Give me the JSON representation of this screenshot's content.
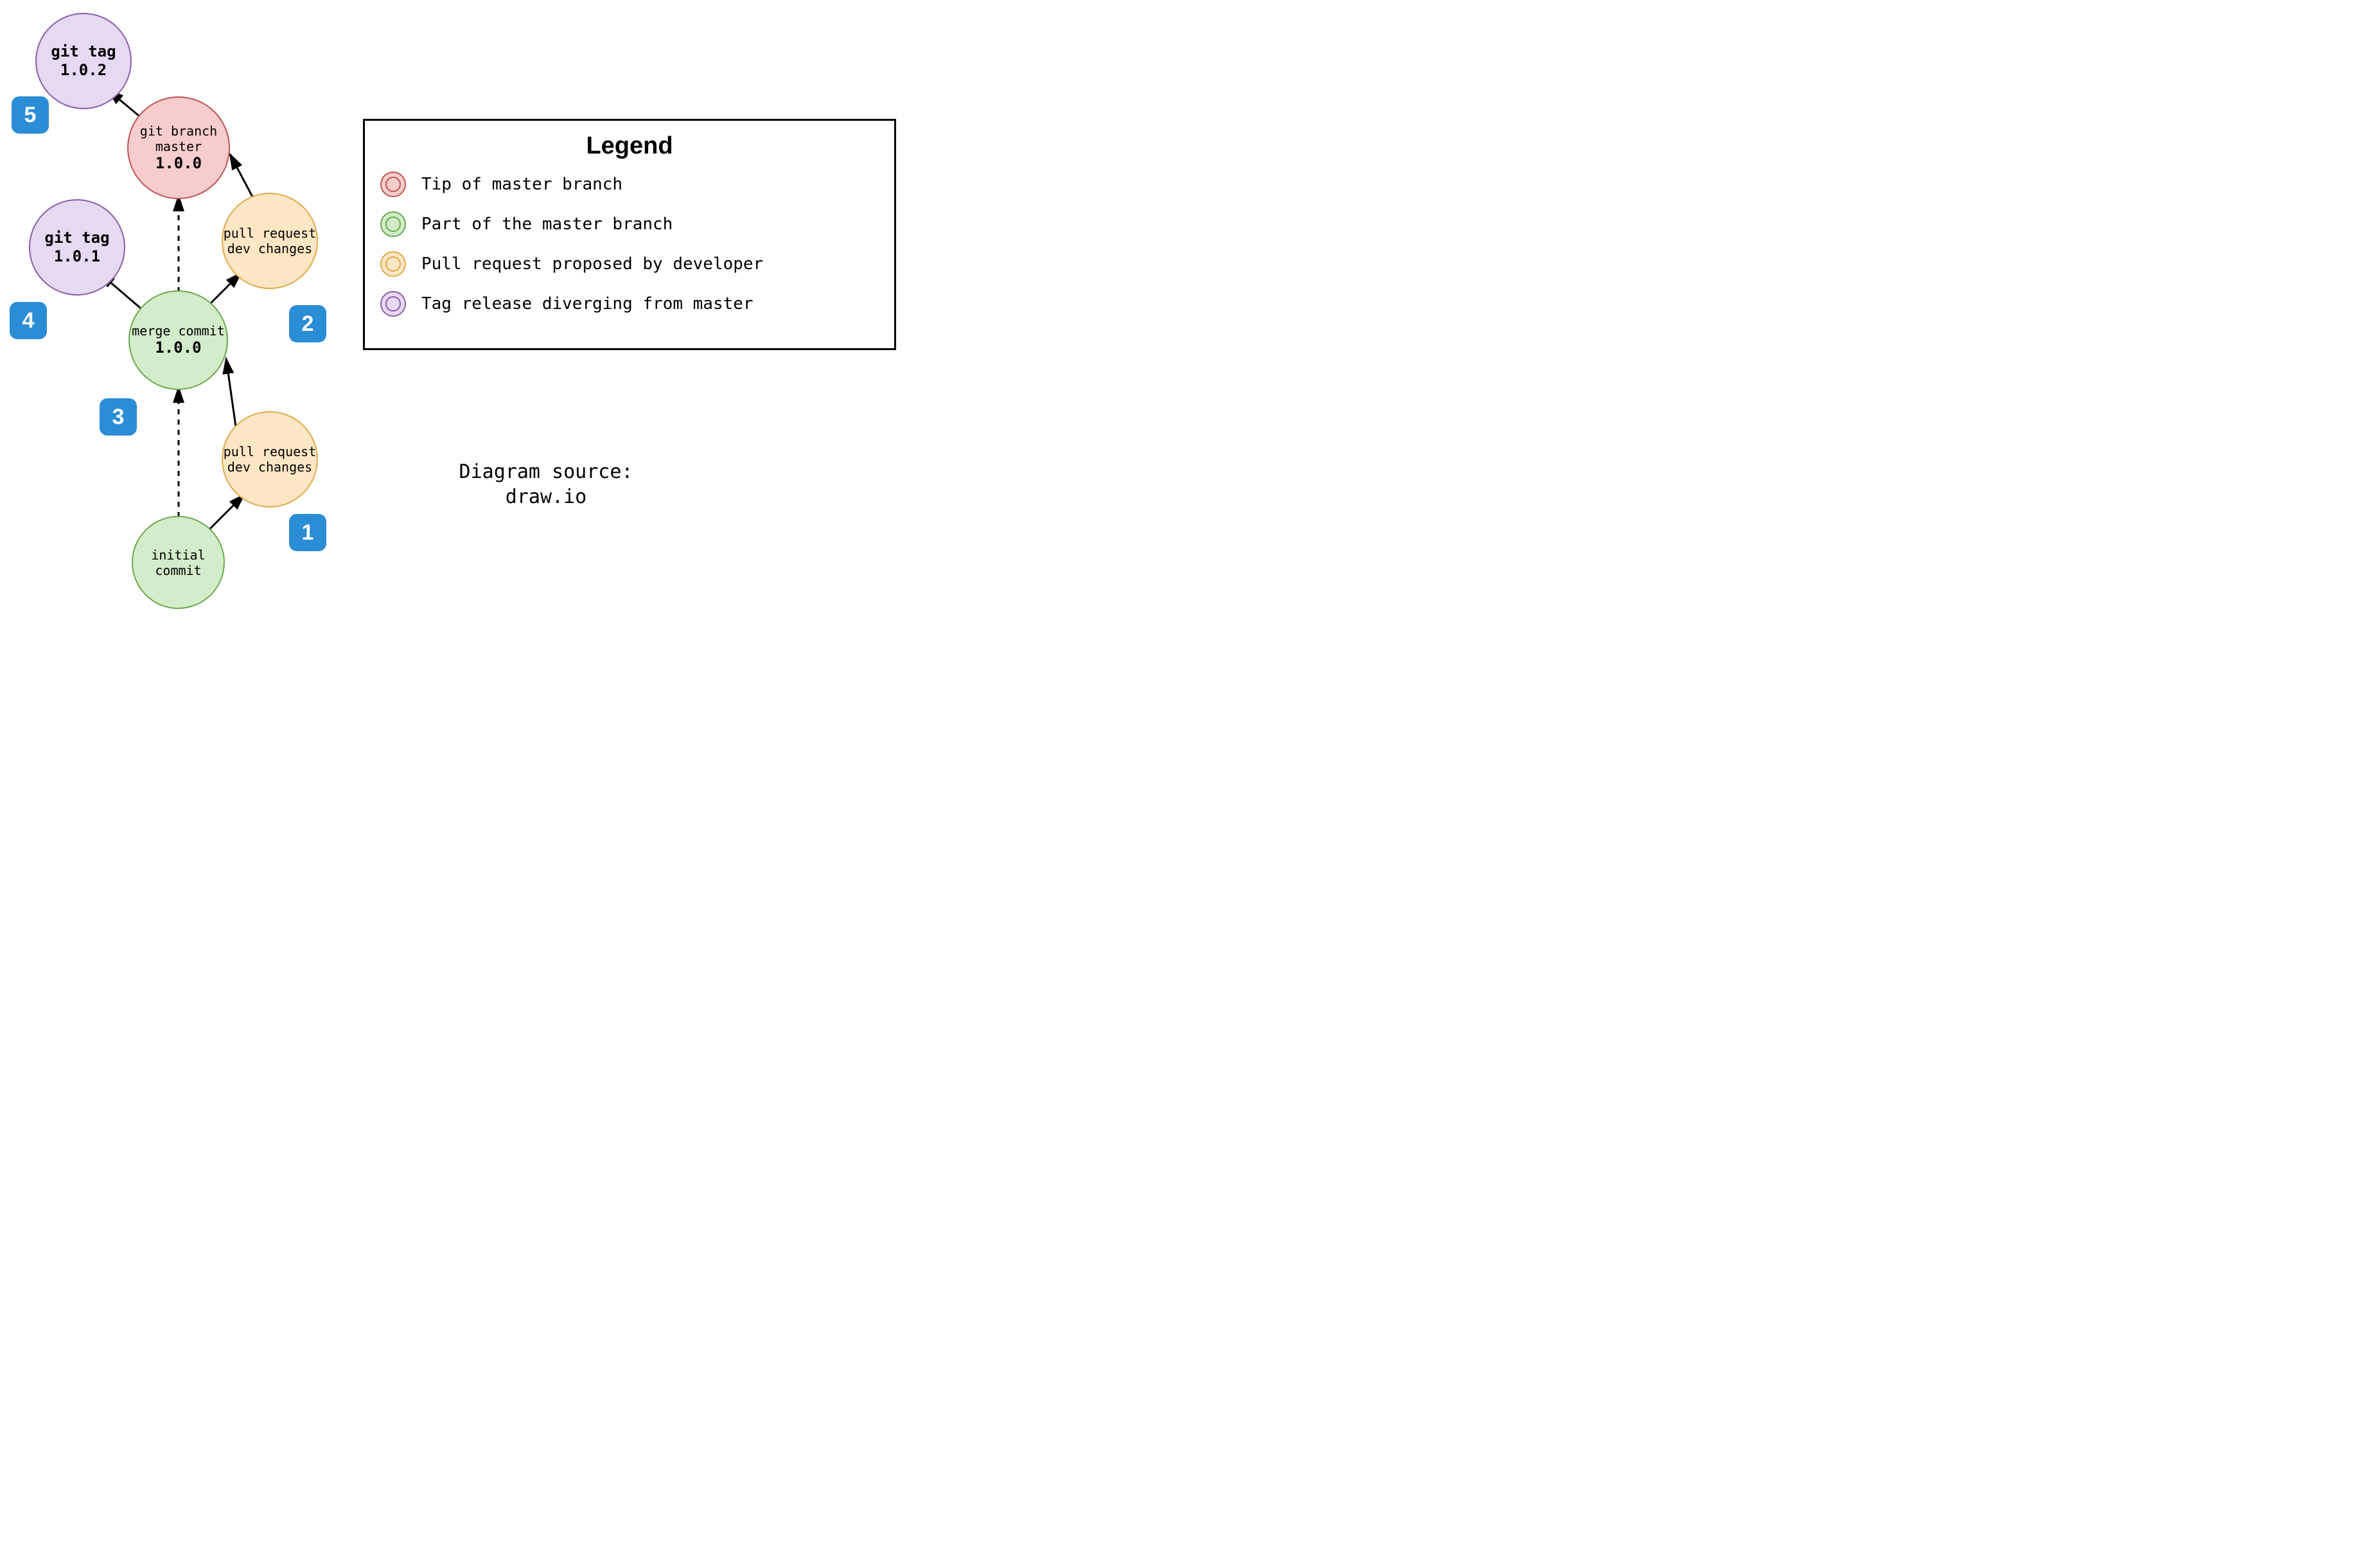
{
  "nodes": {
    "tag102": {
      "line1": "git tag",
      "line2": "1.0.2"
    },
    "tag101": {
      "line1": "git tag",
      "line2": "1.0.1"
    },
    "branchMaster": {
      "line1": "git branch",
      "line2": "master",
      "version": "1.0.0"
    },
    "mergeCommit": {
      "line1": "merge commit",
      "version": "1.0.0"
    },
    "initialCommit": {
      "line1": "initial",
      "line2": "commit"
    },
    "pr1": {
      "line1": "pull request",
      "line2": "dev changes"
    },
    "pr2": {
      "line1": "pull request",
      "line2": "dev changes"
    }
  },
  "steps": {
    "s1": "1",
    "s2": "2",
    "s3": "3",
    "s4": "4",
    "s5": "5"
  },
  "legend": {
    "title": "Legend",
    "items": [
      {
        "color": "red",
        "label": "Tip of master branch"
      },
      {
        "color": "green",
        "label": "Part of the master branch"
      },
      {
        "color": "orange",
        "label": "Pull request proposed by developer"
      },
      {
        "color": "purple",
        "label": "Tag release diverging from master"
      }
    ]
  },
  "source": {
    "line1": "Diagram source:",
    "line2": "draw.io"
  },
  "colors": {
    "purple_fill": "#e6d9f2",
    "purple_stroke": "#8a5ea8",
    "red_fill": "#f6cccc",
    "red_stroke": "#c05555",
    "green_fill": "#d3ecc9",
    "green_stroke": "#6aa84f",
    "orange_fill": "#fde6c4",
    "orange_stroke": "#e0a94c",
    "badge": "#2a8dd6"
  }
}
